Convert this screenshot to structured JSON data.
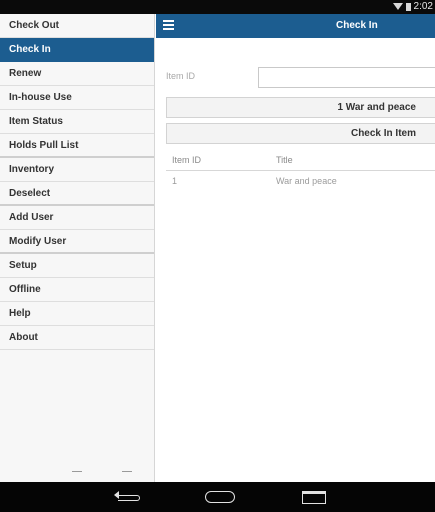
{
  "status_bar": {
    "time": "2:02"
  },
  "sidebar": {
    "items": [
      {
        "label": "Check Out"
      },
      {
        "label": "Check In"
      },
      {
        "label": "Renew"
      },
      {
        "label": "In-house Use"
      },
      {
        "label": "Item Status"
      },
      {
        "label": "Holds Pull List"
      },
      {
        "label": "Inventory"
      },
      {
        "label": "Deselect"
      },
      {
        "label": "Add User"
      },
      {
        "label": "Modify User"
      },
      {
        "label": "Setup"
      },
      {
        "label": "Offline"
      },
      {
        "label": "Help"
      },
      {
        "label": "About"
      }
    ],
    "active_item": "Check In"
  },
  "header": {
    "title": "Check In",
    "menu_icon": "hamburger-menu-icon"
  },
  "form": {
    "item_id_label": "Item ID",
    "item_id_value": "",
    "item_button_label": "1 War and peace",
    "check_in_button_label": "Check In Item"
  },
  "results_table": {
    "columns": [
      "Item ID",
      "Title"
    ],
    "rows": [
      {
        "item_id": "1",
        "title": "War and peace"
      }
    ]
  },
  "colors": {
    "accent": "#1c5d90",
    "sidebar_bg": "#f7f7f7",
    "status_bar_bg": "#0a0a0a"
  },
  "system_nav": {
    "icons": [
      "back-icon",
      "home-icon",
      "recents-icon"
    ]
  }
}
